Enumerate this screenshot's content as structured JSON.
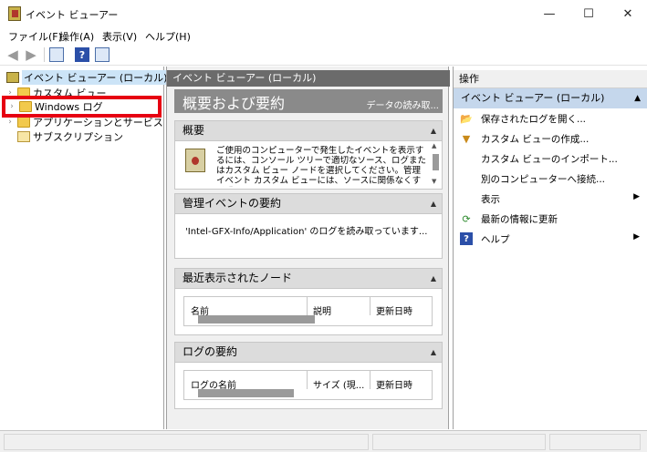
{
  "window": {
    "title": "イベント ビューアー",
    "minimize": "—",
    "maximize": "☐",
    "close": "✕"
  },
  "menu": [
    {
      "label": "ファイル(F)"
    },
    {
      "label": "操作(A)"
    },
    {
      "label": "表示(V)"
    },
    {
      "label": "ヘルプ(H)"
    }
  ],
  "toolbar": {
    "back_icon": "back-arrow-icon",
    "forward_icon": "forward-arrow-icon",
    "help_glyph": "?"
  },
  "tree": {
    "root": "イベント ビューアー (ローカル)",
    "items": [
      {
        "label": "カスタム ビュー",
        "expandable": true
      },
      {
        "label": "Windows ログ",
        "expandable": true,
        "highlighted": true
      },
      {
        "label": "アプリケーションとサービス ログ",
        "expandable": true
      },
      {
        "label": "サブスクリプション",
        "expandable": false
      }
    ]
  },
  "center": {
    "header": "イベント ビューアー (ローカル)",
    "banner_title": "概要および要約",
    "banner_right": "データの読み取...",
    "overview": {
      "title": "概要",
      "text": "ご使用のコンピューターで発生したイベントを表示するには、コンソール ツリーで適切なソース、ログまたはカスタム ビュー ノードを選択してください。管理イベント カスタム ビューには、ソースに関係なくすべて"
    },
    "admin_summary": {
      "title": "管理イベントの要約",
      "status": "'Intel-GFX-Info/Application' のログを読み取っています..."
    },
    "recent_nodes": {
      "title": "最近表示されたノード",
      "columns": [
        "名前",
        "説明",
        "更新日時"
      ]
    },
    "log_summary": {
      "title": "ログの要約",
      "columns": [
        "ログの名前",
        "サイズ (現...",
        "更新日時"
      ]
    }
  },
  "actions": {
    "header": "操作",
    "group": "イベント ビューアー (ローカル)",
    "items": [
      {
        "label": "保存されたログを開く...",
        "icon": "open-folder-icon",
        "submenu": false
      },
      {
        "label": "カスタム ビューの作成...",
        "icon": "filter-icon",
        "submenu": false
      },
      {
        "label": "カスタム ビューのインポート...",
        "icon": "",
        "submenu": false
      },
      {
        "label": "別のコンピューターへ接続...",
        "icon": "",
        "submenu": false
      },
      {
        "label": "表示",
        "icon": "",
        "submenu": true
      },
      {
        "label": "最新の情報に更新",
        "icon": "refresh-icon",
        "submenu": false
      },
      {
        "label": "ヘルプ",
        "icon": "help-icon",
        "submenu": true
      }
    ]
  },
  "colors": {
    "highlight_box": "#e60012",
    "actions_group_bg": "#c5d7ec",
    "center_header_bg": "#6b6b6b"
  }
}
